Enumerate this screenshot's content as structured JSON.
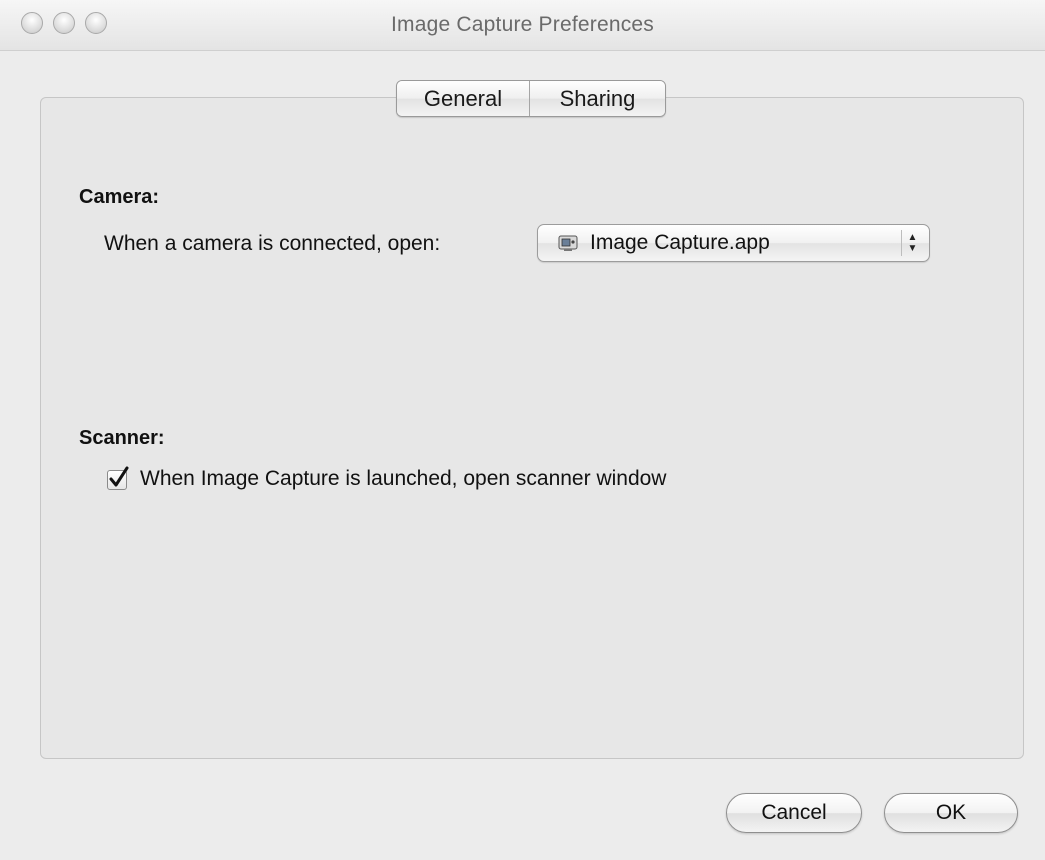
{
  "window": {
    "title": "Image Capture Preferences"
  },
  "tabs": [
    {
      "label": "General",
      "selected": true
    },
    {
      "label": "Sharing",
      "selected": false
    }
  ],
  "camera": {
    "section_label": "Camera:",
    "row_label": "When a camera is connected, open:",
    "popup_value": "Image Capture.app",
    "popup_icon": "app-icon"
  },
  "scanner": {
    "section_label": "Scanner:",
    "checkbox_label": "When Image Capture is launched, open scanner window",
    "checkbox_checked": true
  },
  "buttons": {
    "cancel_label": "Cancel",
    "ok_label": "OK"
  }
}
